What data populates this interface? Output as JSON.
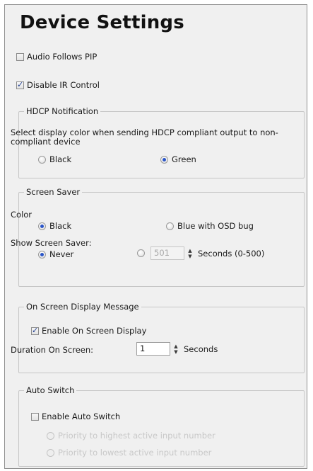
{
  "title": "Device Settings",
  "audio_follows_pip": {
    "label": "Audio Follows PIP",
    "checked": false
  },
  "disable_ir": {
    "label": "Disable IR Control",
    "checked": true
  },
  "hdcp": {
    "legend": "HDCP Notification",
    "description": "Select display color when sending HDCP compliant output to non-compliant device",
    "options": [
      {
        "label": "Black",
        "selected": false
      },
      {
        "label": "Green",
        "selected": true
      }
    ]
  },
  "screen_saver": {
    "legend": "Screen Saver",
    "color_label": "Color",
    "color_options": [
      {
        "label": "Black",
        "selected": true
      },
      {
        "label": "Blue with OSD bug",
        "selected": false
      }
    ],
    "show_label": "Show Screen Saver:",
    "never_label": "Never",
    "seconds_value": "501",
    "seconds_label": "Seconds (0-500)"
  },
  "osd": {
    "legend": "On Screen Display Message",
    "enable_label": "Enable On Screen Display",
    "enabled": true,
    "duration_label": "Duration On Screen:",
    "duration_value": "1",
    "duration_unit": "Seconds"
  },
  "auto_switch": {
    "legend": "Auto Switch",
    "enable_label": "Enable Auto Switch",
    "enabled": false,
    "options": [
      {
        "label": "Priority to highest active input number"
      },
      {
        "label": "Priority to lowest active input number"
      }
    ]
  },
  "colors": {
    "accent": "#2a55c7",
    "panel_bg": "#f0f0f0",
    "disabled_text": "#c8c8c8"
  }
}
